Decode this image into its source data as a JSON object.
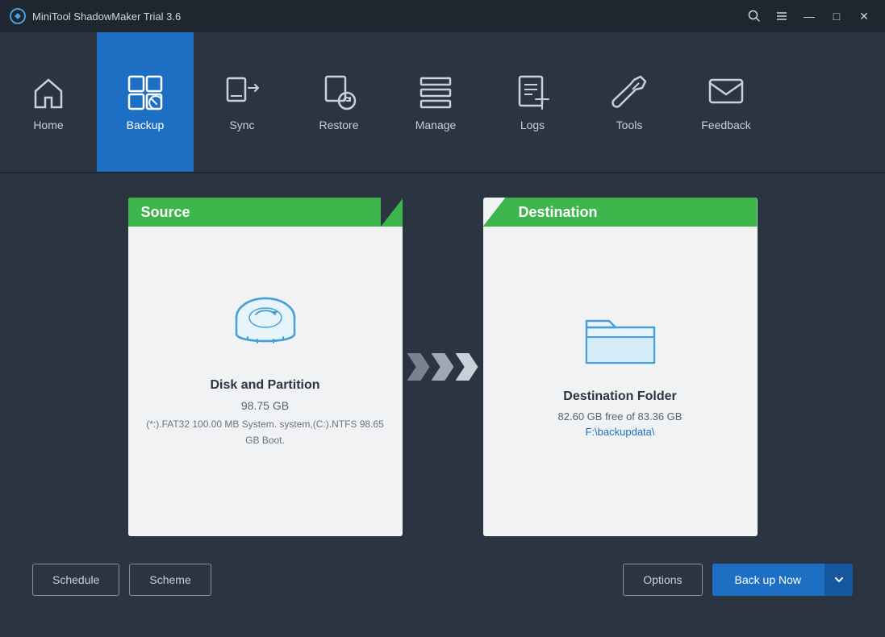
{
  "app": {
    "title": "MiniTool ShadowMaker Trial 3.6"
  },
  "titlebar": {
    "search_icon": "🔍",
    "menu_icon": "☰",
    "minimize_label": "—",
    "maximize_label": "□",
    "close_label": "✕"
  },
  "nav": {
    "items": [
      {
        "id": "home",
        "label": "Home",
        "active": false
      },
      {
        "id": "backup",
        "label": "Backup",
        "active": true
      },
      {
        "id": "sync",
        "label": "Sync",
        "active": false
      },
      {
        "id": "restore",
        "label": "Restore",
        "active": false
      },
      {
        "id": "manage",
        "label": "Manage",
        "active": false
      },
      {
        "id": "logs",
        "label": "Logs",
        "active": false
      },
      {
        "id": "tools",
        "label": "Tools",
        "active": false
      },
      {
        "id": "feedback",
        "label": "Feedback",
        "active": false
      }
    ]
  },
  "source": {
    "header": "Source",
    "title": "Disk and Partition",
    "size": "98.75 GB",
    "detail": "(*:).FAT32 100.00 MB System. system,(C:).NTFS 98.65 GB Boot."
  },
  "destination": {
    "header": "Destination",
    "title": "Destination Folder",
    "free": "82.60 GB free of 83.36 GB",
    "path": "F:\\backupdata\\"
  },
  "toolbar": {
    "schedule_label": "Schedule",
    "scheme_label": "Scheme",
    "options_label": "Options",
    "backup_now_label": "Back up Now"
  }
}
